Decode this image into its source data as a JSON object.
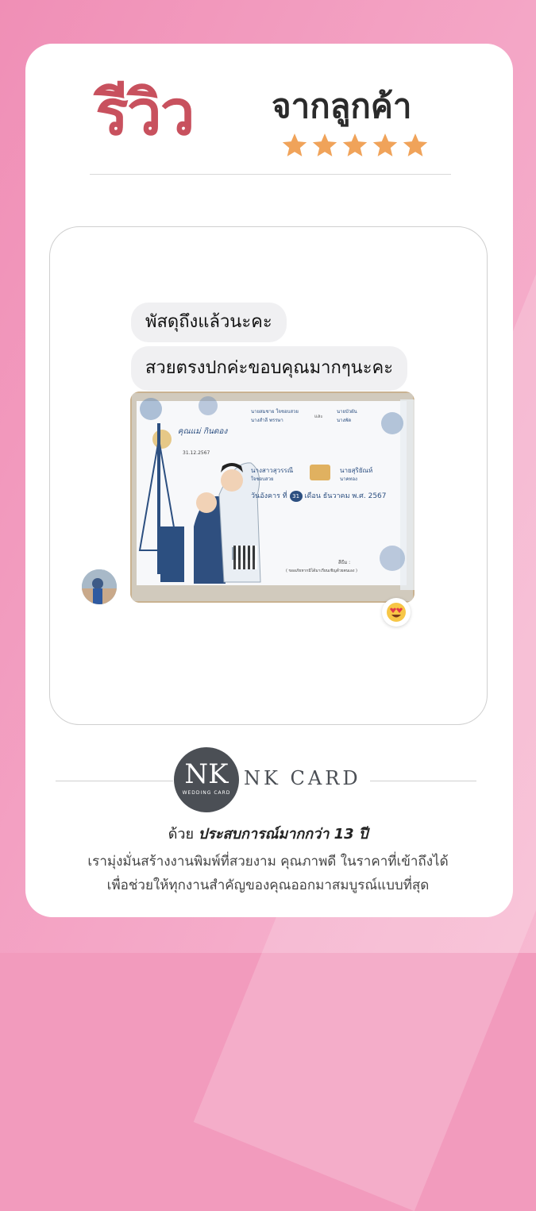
{
  "header": {
    "title_main": "รีวิว",
    "title_sub": "จากลูกค้า",
    "rating_stars": 5,
    "star_color": "#f0a35a"
  },
  "chat": {
    "messages": [
      "พัสดุถึงแล้วนะคะ",
      "สวยตรงปกค่ะขอบคุณมากๆนะคะ"
    ],
    "reaction_icon": "heart-eyes-emoji-icon",
    "photo": {
      "card_text": {
        "cover_title": "คุณแม่ กินดอง",
        "cover_date": "31.12.2567",
        "parents_left_1": "นายสมชาย  ใจชอบสวย",
        "parents_left_2": "นางสำลี  พรรษา",
        "and": "และ",
        "parents_right_1": "นายบัวผัน",
        "parents_right_2": "นางพัด",
        "bride": "นางสาวสุวรรณี",
        "bride_surname": "ใจชอบสวย",
        "groom": "นายสุริยัณห์",
        "groom_surname": "นาคทอง",
        "date_prefix": "วันอังคาร ที่",
        "date_day": "31",
        "date_suffix": "เดือน ธันวาคม พ.ศ. 2567",
        "footer_note": "( ขออภัยหากมิได้มาเรียนเชิญด้วยตนเอง )",
        "color_label": "สีธีม :"
      }
    }
  },
  "brand": {
    "logo_letters": "NK",
    "logo_subtitle": "WEDDING CARD",
    "name": "NK CARD",
    "experience_prefix": "ด้วย",
    "experience_bold": "ประสบการณ์มากกว่า 13 ปี",
    "tagline_1": "เรามุ่งมั่นสร้างงานพิมพ์ที่สวยงาม คุณภาพดี ในราคาที่เข้าถึงได้",
    "tagline_2": "เพื่อช่วยให้ทุกงานสำคัญของคุณออกมาสมบูรณ์แบบที่สุด"
  }
}
